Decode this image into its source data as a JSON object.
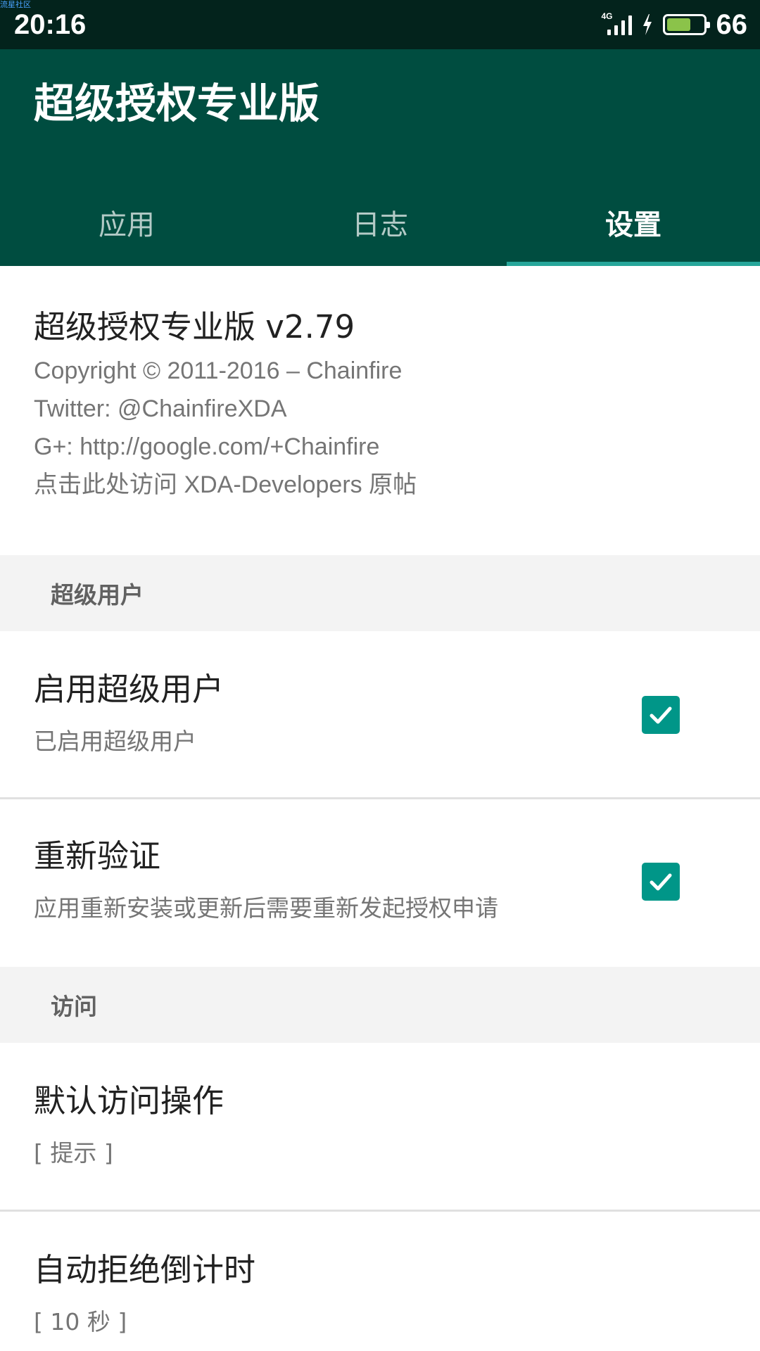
{
  "status_bar": {
    "watermark": "流星社区",
    "time": "20:16",
    "network": "4G",
    "battery_level": 66,
    "battery_text": "66",
    "battery_color": "#8bc34a",
    "icons": [
      "signal-icon",
      "charging-bolt-icon",
      "battery-icon"
    ]
  },
  "app_bar": {
    "title": "超级授权专业版",
    "background_color": "#004d40"
  },
  "tabs": [
    {
      "label": "应用",
      "active": false
    },
    {
      "label": "日志",
      "active": false
    },
    {
      "label": "设置",
      "active": true
    }
  ],
  "about": {
    "title": "超级授权专业版 v2.79",
    "lines": [
      "Copyright © 2011-2016 – Chainfire",
      "Twitter: @ChainfireXDA",
      "G+: http://google.com/+Chainfire",
      "点击此处访问 XDA-Developers 原帖"
    ]
  },
  "sections": [
    {
      "header": "超级用户",
      "prefs": [
        {
          "title": "启用超级用户",
          "summary": "已启用超级用户",
          "checked": true
        },
        {
          "title": "重新验证",
          "summary": "应用重新安装或更新后需要重新发起授权申请",
          "checked": true
        }
      ]
    },
    {
      "header": "访问",
      "prefs": [
        {
          "title": "默认访问操作",
          "summary": "[ 提示 ]"
        },
        {
          "title": "自动拒绝倒计时",
          "summary": "[ 10 秒 ]"
        }
      ]
    }
  ],
  "accent_color": "#009688"
}
